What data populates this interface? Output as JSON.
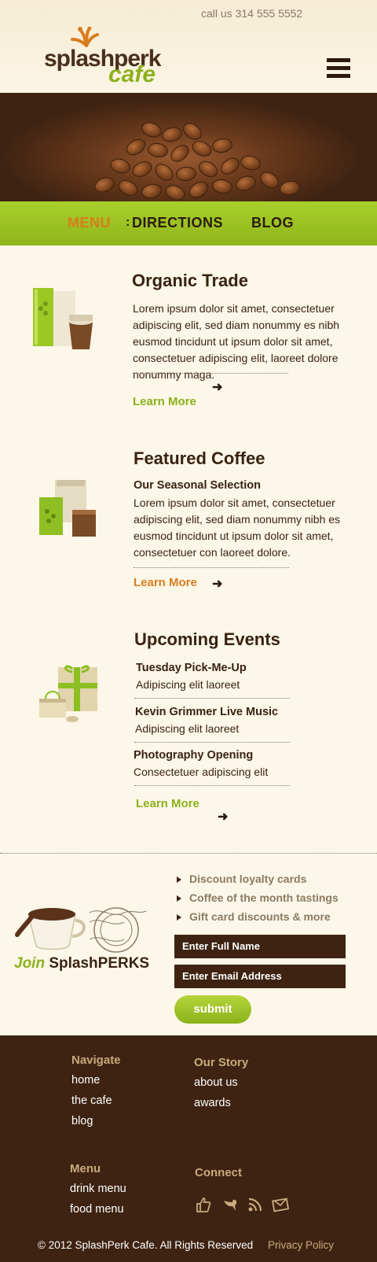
{
  "header": {
    "phone": "call us 314 555 5552",
    "logo_line1": "splashperk",
    "logo_line2": "cafe"
  },
  "nav": {
    "items": [
      {
        "label": "MENU"
      },
      {
        "label": "DIRECTIONS"
      },
      {
        "label": "BLOG"
      }
    ],
    "separator": ":"
  },
  "sections": {
    "organic": {
      "title": "Organic Trade",
      "body": "Lorem ipsum dolor sit amet, consectetuer adipiscing elit, sed diam nonummy es nibh eusmod tincidunt ut ipsum dolor sit amet, consectetuer adipiscing elit, laoreet dolore nonummy maga.",
      "learn_more": "Learn More"
    },
    "featured": {
      "title": "Featured Coffee",
      "subtitle": "Our Seasonal Selection",
      "body": "Lorem ipsum dolor sit amet, consectetuer adipiscing elit, sed diam nonummy nibh es eusmod tincidunt ut ipsum dolor sit amet, consectetuer con laoreet dolore.",
      "learn_more": "Learn More"
    },
    "events": {
      "title": "Upcoming Events",
      "items": [
        {
          "name": "Tuesday Pick-Me-Up",
          "desc": "Adipiscing elit laoreet"
        },
        {
          "name": "Kevin Grimmer Live Music",
          "desc": "Adipiscing elit laoreet"
        },
        {
          "name": "Photography Opening",
          "desc": "Consectetuer adipiscing elit"
        }
      ],
      "learn_more": "Learn More"
    }
  },
  "join": {
    "logo_join": "Join",
    "logo_brand": "SplashPERKS",
    "bullets": [
      "Discount loyalty cards",
      "Coffee of the month tastings",
      "Gift card discounts & more"
    ],
    "name_placeholder": "Enter Full Name",
    "email_placeholder": "Enter Email Address",
    "submit": "submit"
  },
  "footer": {
    "navigate": {
      "heading": "Navigate",
      "links": [
        "home",
        "the cafe",
        "blog"
      ]
    },
    "our_story": {
      "heading": "Our Story",
      "links": [
        "about us",
        "awards"
      ]
    },
    "menu": {
      "heading": "Menu",
      "links": [
        "drink menu",
        "food menu"
      ]
    },
    "connect": {
      "heading": "Connect",
      "icons": [
        "thumbs-up-icon",
        "bird-icon",
        "rss-icon",
        "envelope-icon"
      ]
    },
    "copyright": "© 2012 SplashPerk Cafe. All Rights Reserved",
    "privacy": "Privacy Policy"
  },
  "colors": {
    "brown": "#3e2312",
    "green": "#8cb11c",
    "orange": "#d97d1e",
    "tan": "#c9ab7c",
    "cream": "#fcf7e8"
  }
}
